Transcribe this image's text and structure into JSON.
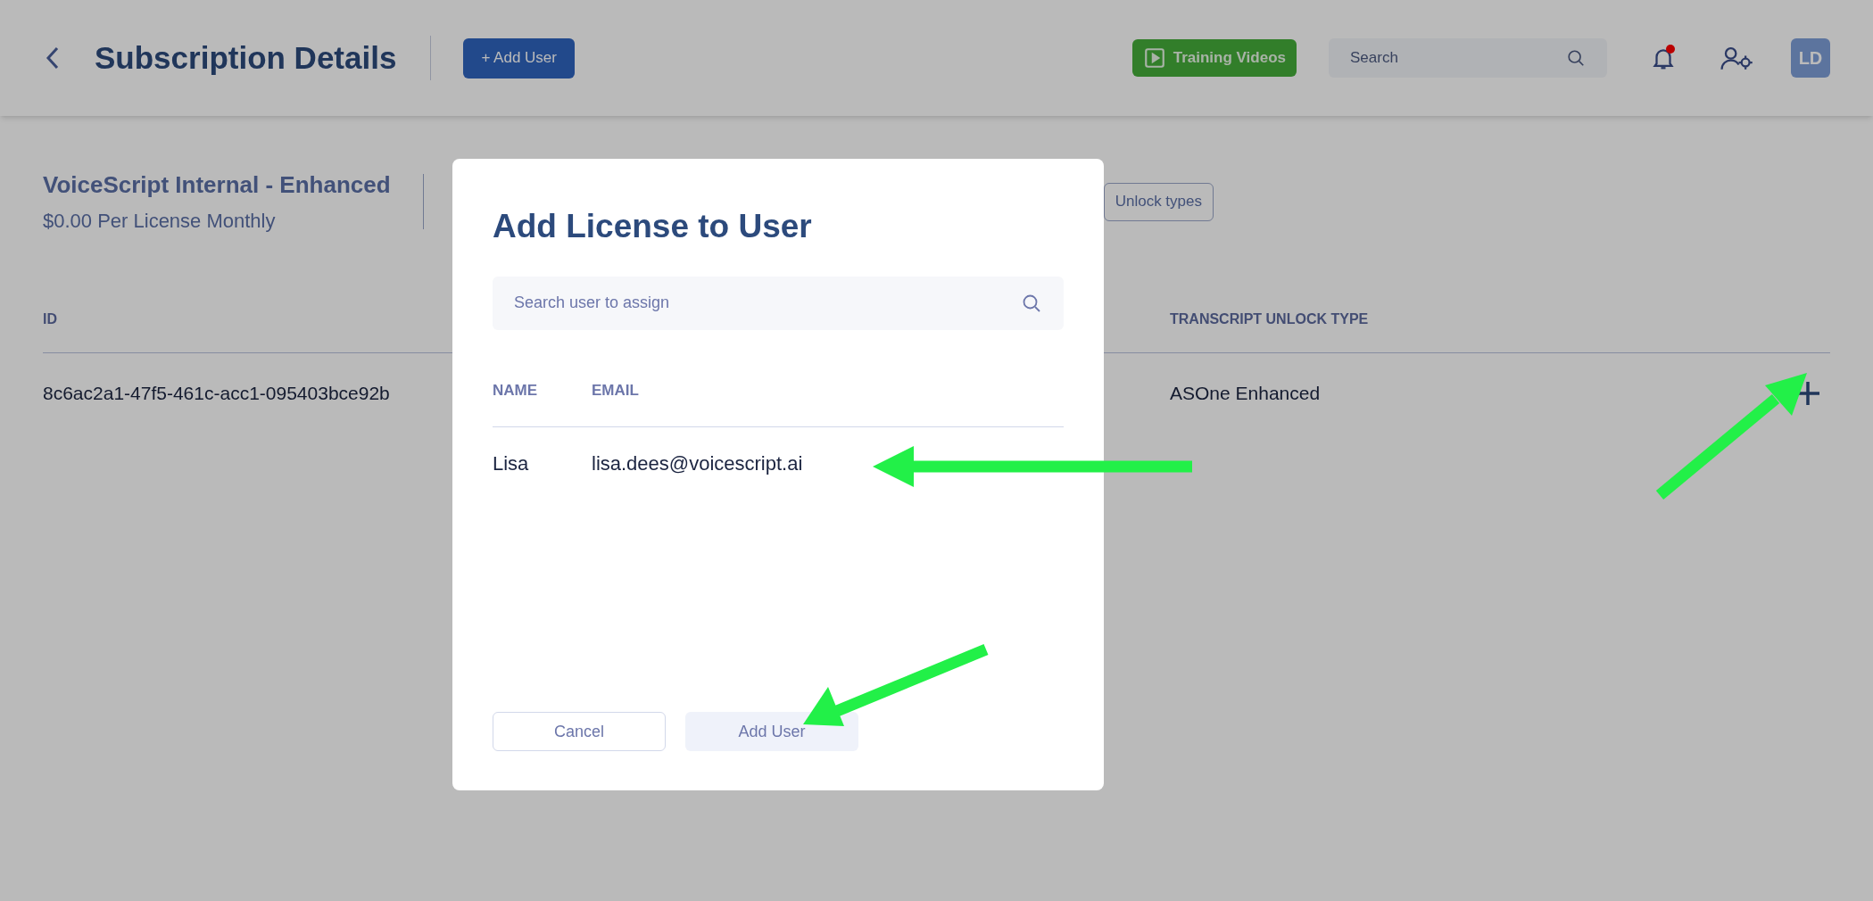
{
  "header": {
    "title": "Subscription Details",
    "add_user_button": "+ Add User",
    "training_button": "Training Videos",
    "search": {
      "placeholder": "Search"
    },
    "notifications": {
      "unread": true
    },
    "avatar": "LD"
  },
  "plan": {
    "name": "VoiceScript Internal - Enhanced",
    "price": "$0.00 Per License Monthly",
    "unlock_types_button": "Unlock types"
  },
  "table": {
    "columns": [
      "ID",
      "TRANSCRIPT UNLOCK TYPE"
    ],
    "rows": [
      {
        "cells": [
          "8c6ac2a1-47f5-461c-acc1-095403bce92b",
          "ASOne Enhanced"
        ]
      }
    ]
  },
  "modal": {
    "title": "Add License to User",
    "search": {
      "placeholder": "Search user to assign"
    },
    "columns": [
      "NAME",
      "EMAIL"
    ],
    "rows": [
      {
        "name": "Lisa",
        "email": "lisa.dees@voicescript.ai"
      }
    ],
    "buttons": [
      {
        "label": "Cancel",
        "kind": "secondary"
      },
      {
        "label": "Add User",
        "kind": "primary"
      }
    ]
  }
}
